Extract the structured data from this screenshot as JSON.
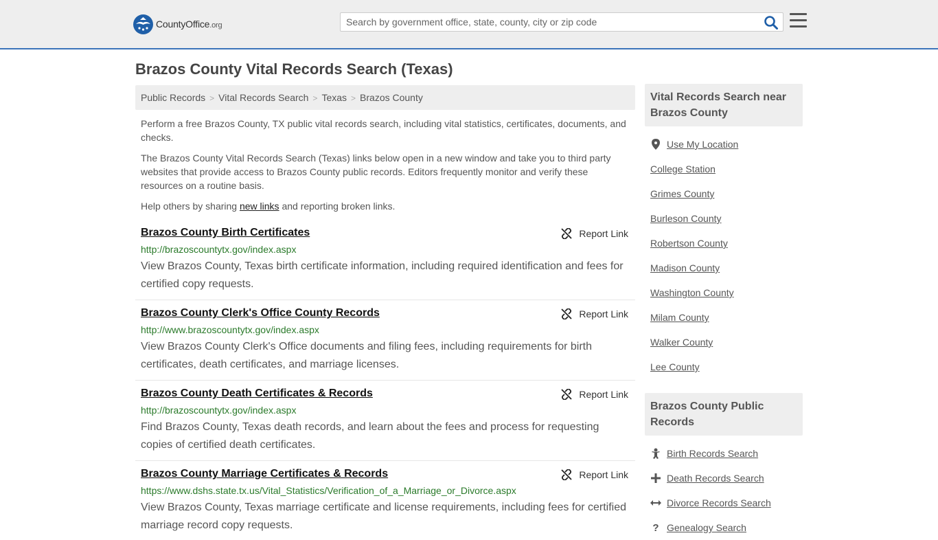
{
  "header": {
    "logo_text": "CountyOffice",
    "logo_tld": ".org",
    "search_placeholder": "Search by government office, state, county, city or zip code"
  },
  "page_title": "Brazos County Vital Records Search (Texas)",
  "breadcrumb": [
    "Public Records",
    "Vital Records Search",
    "Texas",
    "Brazos County"
  ],
  "intro": {
    "p1": "Perform a free Brazos County, TX public vital records search, including vital statistics, certificates, documents, and checks.",
    "p2": "The Brazos County Vital Records Search (Texas) links below open in a new window and take you to third party websites that provide access to Brazos County public records. Editors frequently monitor and verify these resources on a routine basis.",
    "p3_before": "Help others by sharing ",
    "p3_link": "new links",
    "p3_after": " and reporting broken links."
  },
  "report_label": "Report Link",
  "entries": [
    {
      "title": "Brazos County Birth Certificates",
      "url": "http://brazoscountytx.gov/index.aspx",
      "desc": "View Brazos County, Texas birth certificate information, including required identification and fees for certified copy requests."
    },
    {
      "title": "Brazos County Clerk's Office County Records",
      "url": "http://www.brazoscountytx.gov/index.aspx",
      "desc": "View Brazos County Clerk's Office documents and filing fees, including requirements for birth certificates, death certificates, and marriage licenses."
    },
    {
      "title": "Brazos County Death Certificates & Records",
      "url": "http://brazoscountytx.gov/index.aspx",
      "desc": "Find Brazos County, Texas death records, and learn about the fees and process for requesting copies of certified death certificates."
    },
    {
      "title": "Brazos County Marriage Certificates & Records",
      "url": "https://www.dshs.state.tx.us/Vital_Statistics/Verification_of_a_Marriage_or_Divorce.aspx",
      "desc": "View Brazos County, Texas marriage certificate and license requirements, including fees for certified marriage record copy requests."
    }
  ],
  "sidebar": {
    "near_heading": "Vital Records Search near Brazos County",
    "near_items": [
      "Use My Location",
      "College Station",
      "Grimes County",
      "Burleson County",
      "Robertson County",
      "Madison County",
      "Washington County",
      "Milam County",
      "Walker County",
      "Lee County"
    ],
    "public_heading": "Brazos County Public Records",
    "public_items": [
      {
        "label": "Birth Records Search",
        "icon": "baby-icon"
      },
      {
        "label": "Death Records Search",
        "icon": "cross-icon"
      },
      {
        "label": "Divorce Records Search",
        "icon": "arrows-icon"
      },
      {
        "label": "Genealogy Search",
        "icon": "question-icon"
      }
    ]
  },
  "colors": {
    "accent": "#3b73b9",
    "url_green": "#2a7a2a",
    "panel_bg": "#eeeeee"
  }
}
